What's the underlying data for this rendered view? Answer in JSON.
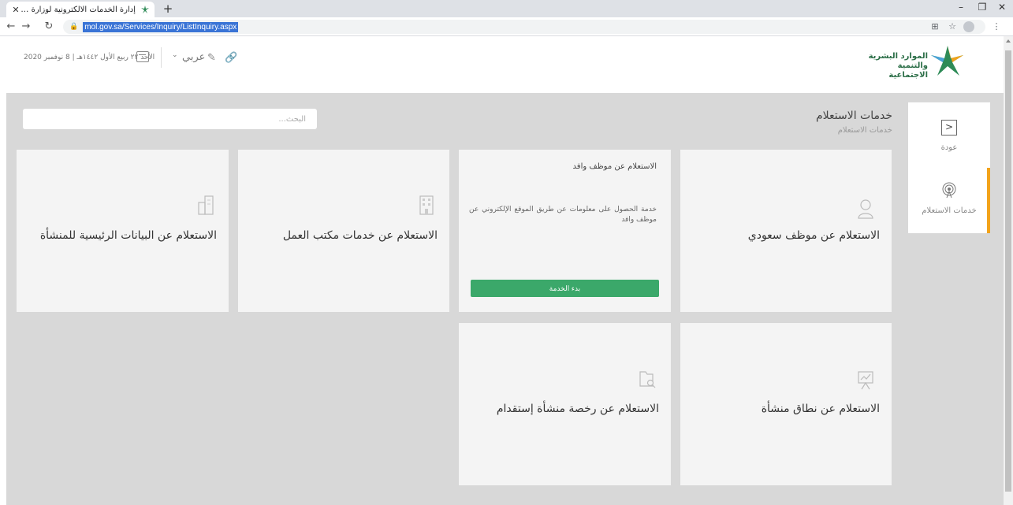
{
  "browser": {
    "tab_title": "إدارة الخدمات الالكترونية لوزارة الم",
    "url": "mol.gov.sa/Services/Inquiry/ListInquiry.aspx"
  },
  "header": {
    "date_text": "الأحد ٢٢ ربيع الأول ١٤٤٢هـ | 8 نوفمبر 2020",
    "language": "عربي",
    "logo_text_line1": "الموارد البشرية",
    "logo_text_line2": "والتنمية الاجتماعية"
  },
  "sidebar": {
    "back_label": "عودة",
    "inquiry_label": "خدمات الاستعلام"
  },
  "page": {
    "title": "خدمات الاستعلام",
    "breadcrumb": "خدمات الاستعلام",
    "search_placeholder": "البحث..."
  },
  "cards": {
    "saudi_employee": "الاستعلام عن موظف سعودي",
    "expat": {
      "title": "الاستعلام عن موظف وافد",
      "description": "خدمة الحصول على معلومات عن طريق الموقع الإلكتروني عن موظف وافد",
      "button": "بدء الخدمة"
    },
    "labor_office": "الاستعلام عن خدمات مكتب العمل",
    "establishment_data": "الاستعلام عن البيانات الرئيسية للمنشأة",
    "nitaqat": "الاستعلام عن نطاق منشأة",
    "recruitment_license": "الاستعلام عن رخصة منشأة إستقدام"
  },
  "colors": {
    "accent_orange": "#f2a31b",
    "button_green": "#3ba86a",
    "content_gray": "#d8d8d8"
  }
}
